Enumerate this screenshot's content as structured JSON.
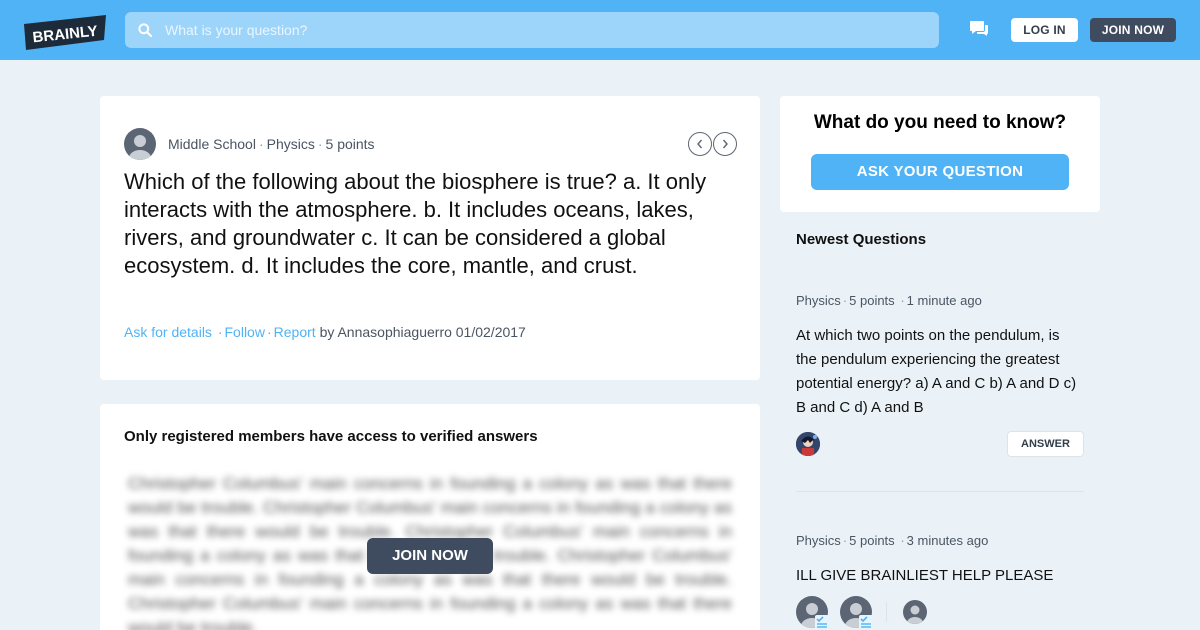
{
  "header": {
    "logo_text": "BRAINLY",
    "search_placeholder": "What is your question?",
    "login_label": "LOG IN",
    "join_label": "JOIN NOW"
  },
  "question": {
    "level": "Middle School",
    "subject": "Physics",
    "points": "5 points",
    "text": "Which of the following about the biosphere is true? a. It only interacts with the atmosphere. b. It includes oceans, lakes, rivers, and groundwater c. It can be considered a global ecosystem. d. It includes the core, mantle, and crust.",
    "ask_details": "Ask for details",
    "follow": "Follow",
    "report": "Report",
    "by_author": "by Annasophiaguerro 01/02/2017"
  },
  "answers": {
    "title": "Only registered members have access to verified answers",
    "blurred_text": "Christopher Columbus' main concerns in founding a colony as was that there would be trouble. Christopher Columbus' main concerns in founding a colony as was that there would be trouble. Christopher Columbus' main concerns in founding a colony as was that there would be trouble. Christopher Columbus' main concerns in founding a colony as was that there would be trouble. Christopher Columbus' main concerns in founding a colony as was that there would be trouble.",
    "join_label": "JOIN NOW"
  },
  "ask_box": {
    "title": "What do you need to know?",
    "button_label": "ASK YOUR QUESTION"
  },
  "newest": {
    "title": "Newest Questions",
    "items": [
      {
        "subject": "Physics",
        "points": "5 points",
        "time": "1 minute ago",
        "text": "At which two points on the pendulum, is the pendulum experiencing the greatest potential energy? a) A and C b) A and D c) B and C d) A and B",
        "answer_label": "ANSWER"
      },
      {
        "subject": "Physics",
        "points": "5 points",
        "time": "3 minutes ago",
        "text": "ILL GIVE BRAINLIEST HELP PLEASE"
      }
    ]
  },
  "colors": {
    "brand_blue": "#4fb3f6",
    "dark_button": "#3f4c5f",
    "page_bg": "#ebf2f7"
  }
}
